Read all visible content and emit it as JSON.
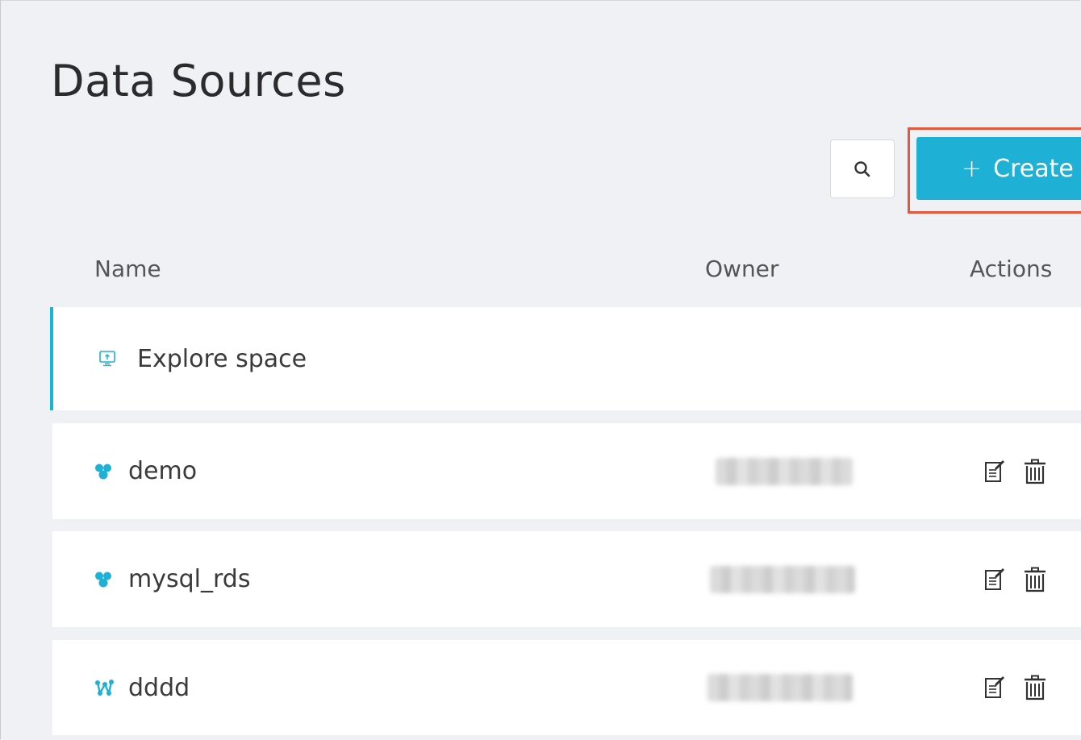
{
  "page": {
    "title": "Data Sources"
  },
  "toolbar": {
    "search_icon": "search-icon",
    "create_label": "Create",
    "create_icon": "plus"
  },
  "table": {
    "columns": {
      "name": "Name",
      "owner": "Owner",
      "actions": "Actions"
    },
    "rows": [
      {
        "name": "Explore space",
        "icon": "monitor-upload-icon",
        "has_actions": false
      },
      {
        "name": "demo",
        "icon": "database-cluster-icon",
        "has_actions": true
      },
      {
        "name": "mysql_rds",
        "icon": "database-cluster-icon",
        "has_actions": true
      },
      {
        "name": "dddd",
        "icon": "graph-nodes-icon",
        "has_actions": true
      }
    ]
  },
  "colors": {
    "accent": "#1fb0d6",
    "highlight": "#e4573b",
    "background": "#f0f1f4"
  }
}
